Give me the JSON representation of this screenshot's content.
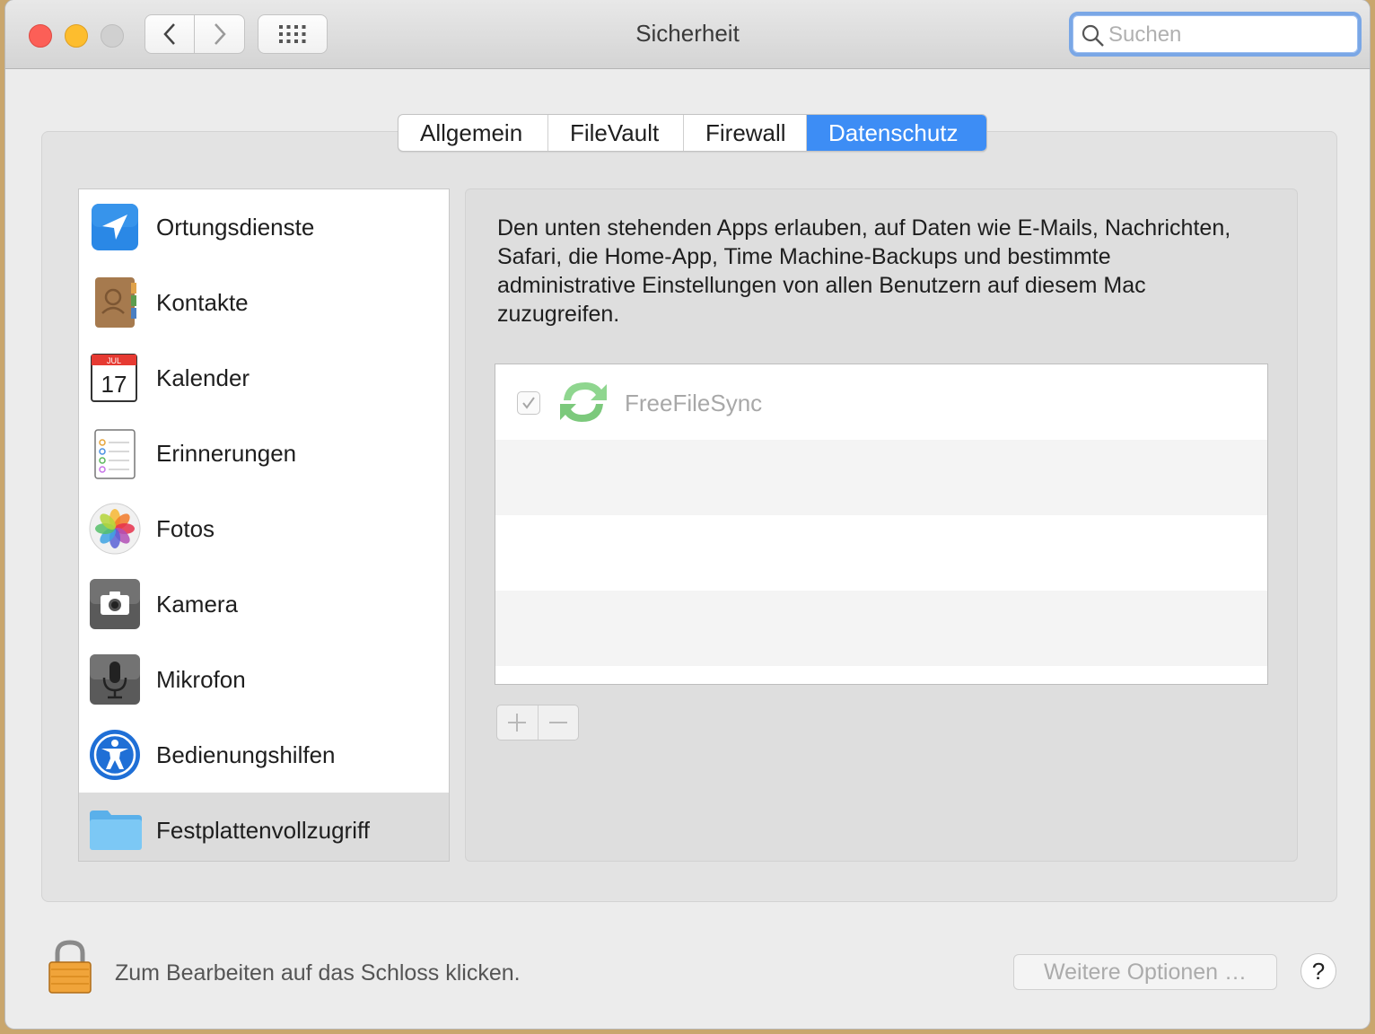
{
  "window": {
    "title": "Sicherheit",
    "search_placeholder": "Suchen"
  },
  "tabs": [
    {
      "label": "Allgemein",
      "active": false
    },
    {
      "label": "FileVault",
      "active": false
    },
    {
      "label": "Firewall",
      "active": false
    },
    {
      "label": "Datenschutz",
      "active": true
    }
  ],
  "sidebar": {
    "items": [
      {
        "label": "Ortungsdienste",
        "icon": "location-icon"
      },
      {
        "label": "Kontakte",
        "icon": "contacts-icon"
      },
      {
        "label": "Kalender",
        "icon": "calendar-icon",
        "calendar_month": "JUL",
        "calendar_day": "17"
      },
      {
        "label": "Erinnerungen",
        "icon": "reminders-icon"
      },
      {
        "label": "Fotos",
        "icon": "photos-icon"
      },
      {
        "label": "Kamera",
        "icon": "camera-icon"
      },
      {
        "label": "Mikrofon",
        "icon": "microphone-icon"
      },
      {
        "label": "Bedienungshilfen",
        "icon": "accessibility-icon"
      },
      {
        "label": "Festplattenvollzugriff",
        "icon": "folder-icon",
        "selected": true
      }
    ]
  },
  "main": {
    "description": "Den unten stehenden Apps erlauben, auf Daten wie E-Mails, Nachrichten, Safari, die Home-App, Time Machine-Backups und bestimmte administrative Einstellungen von allen Benutzern auf diesem Mac zuzugreifen.",
    "apps": [
      {
        "name": "FreeFileSync",
        "checked": true,
        "icon": "freefilesync-icon"
      }
    ]
  },
  "footer": {
    "lock_text": "Zum Bearbeiten auf das Schloss klicken.",
    "more_options_label": "Weitere Optionen …",
    "help_label": "?"
  },
  "colors": {
    "accent": "#3d8df5",
    "close": "#fc5f57",
    "minimize": "#fdbd2e"
  }
}
